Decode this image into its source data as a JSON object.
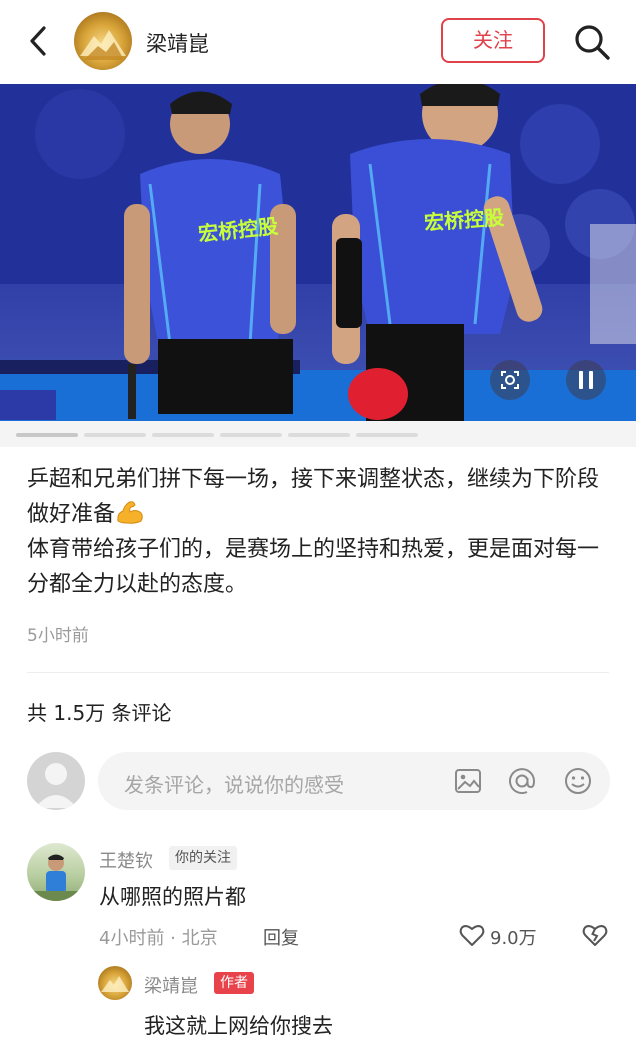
{
  "header": {
    "author_name": "梁靖崑",
    "follow_label": "关注",
    "back_icon": "chevron-left-icon",
    "search_icon": "search-icon"
  },
  "media": {
    "jersey_text": "宏桥控股",
    "zoom_icon": "zoom-icon",
    "pause_icon": "pause-icon",
    "page_count": 6,
    "current_page": 1
  },
  "post": {
    "lines": [
      "乒超和兄弟们拼下每一场，接下来调整状态，继续为下阶段做好准备",
      "体育带给孩子们的，是赛场上的坚持和热爱，更是面对每一分都全力以赴的态度。"
    ],
    "emoji": "flexed-biceps-icon",
    "time": "5小时前"
  },
  "comments_header": {
    "count_label": "共 1.5万 条评论"
  },
  "comment_input": {
    "placeholder": "发条评论，说说你的感受",
    "icons": [
      "image-icon",
      "at-icon",
      "emoji-icon"
    ]
  },
  "comments": [
    {
      "name": "王楚钦",
      "badge": "你的关注",
      "text": "从哪照的照片都",
      "meta": "4小时前 · 北京",
      "reply_label": "回复",
      "likes": "9.0万",
      "reply": {
        "name": "梁靖崑",
        "badge": "作者",
        "text": "我这就上网给你搜去"
      }
    }
  ],
  "colors": {
    "accent": "#e0424a",
    "muted": "#9a9a9a",
    "text": "#222222"
  }
}
